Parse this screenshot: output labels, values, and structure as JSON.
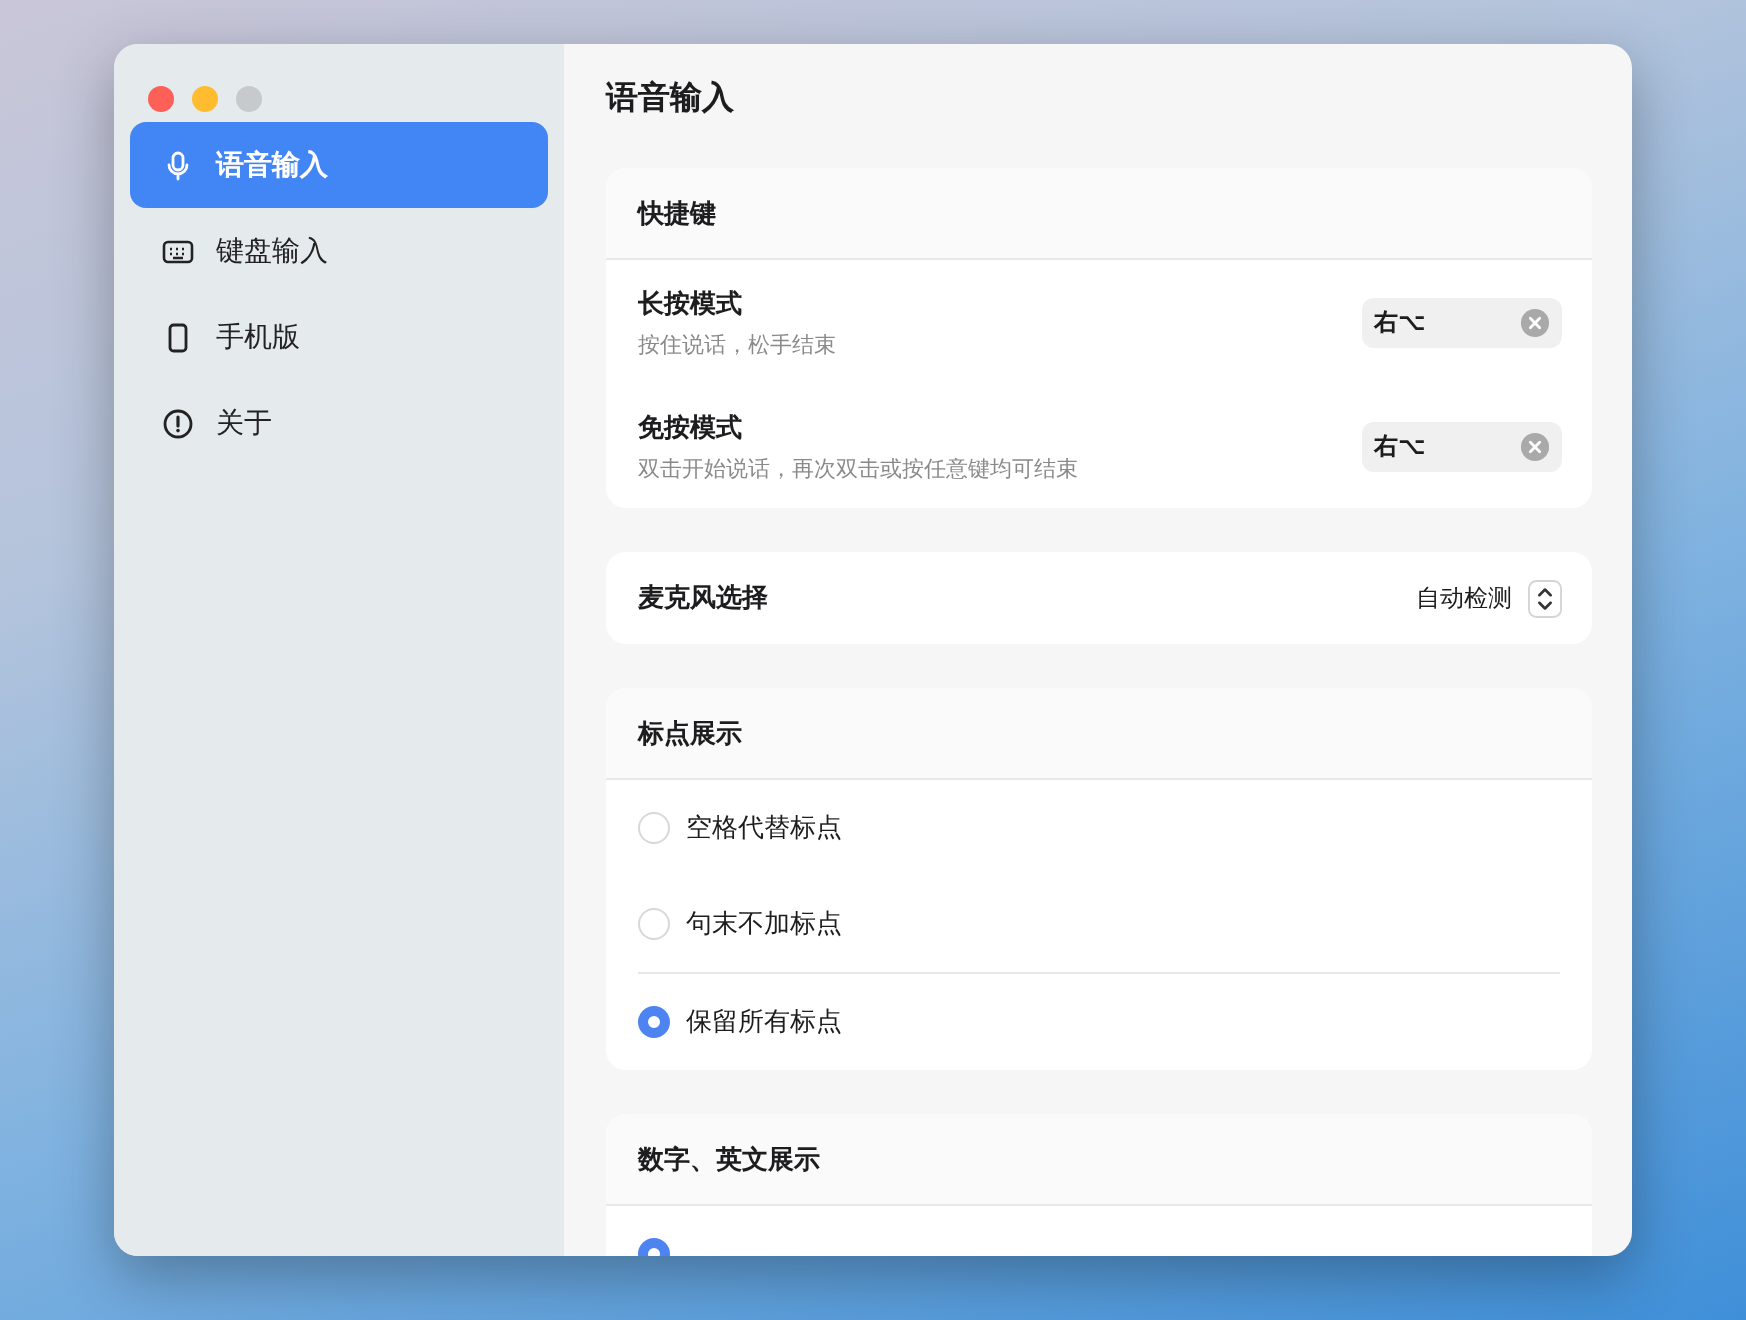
{
  "sidebar": {
    "items": [
      {
        "label": "语音输入",
        "kind": "mic",
        "selected": true
      },
      {
        "label": "键盘输入",
        "kind": "keyboard",
        "selected": false
      },
      {
        "label": "手机版",
        "kind": "phone",
        "selected": false
      },
      {
        "label": "关于",
        "kind": "info",
        "selected": false
      }
    ]
  },
  "page_title": "语音输入",
  "shortcuts": {
    "title": "快捷键",
    "rows": [
      {
        "name": "长按模式",
        "description": "按住说话，松手结束",
        "key": "右⌥"
      },
      {
        "name": "免按模式",
        "description": "双击开始说话，再次双击或按任意键均可结束",
        "key": "右⌥"
      }
    ]
  },
  "microphone": {
    "label": "麦克风选择",
    "value": "自动检测"
  },
  "punctuation": {
    "title": "标点展示",
    "options": [
      {
        "label": "空格代替标点",
        "selected": false
      },
      {
        "label": "句末不加标点",
        "selected": false
      },
      {
        "label": "保留所有标点",
        "selected": true
      }
    ]
  },
  "numbers": {
    "title": "数字、英文展示",
    "options": [
      {
        "selected": true
      }
    ]
  }
}
